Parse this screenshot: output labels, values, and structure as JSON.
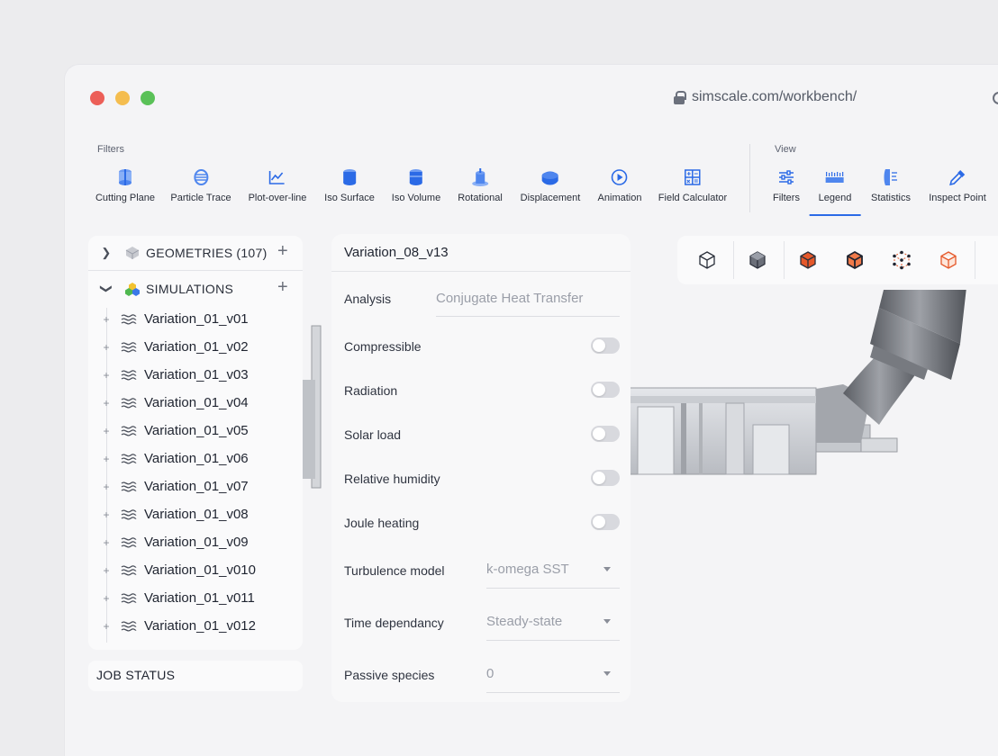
{
  "browser": {
    "url": "simscale.com/workbench/"
  },
  "toolbar": {
    "filters_label": "Filters",
    "view_label": "View",
    "filters": [
      {
        "label": "Cutting Plane",
        "icon": "cutting-plane-icon"
      },
      {
        "label": "Particle Trace",
        "icon": "particle-trace-icon"
      },
      {
        "label": "Plot-over-line",
        "icon": "plot-over-line-icon"
      },
      {
        "label": "Iso Surface",
        "icon": "iso-surface-icon"
      },
      {
        "label": "Iso Volume",
        "icon": "iso-volume-icon"
      },
      {
        "label": "Rotational",
        "icon": "rotational-icon"
      },
      {
        "label": "Displacement",
        "icon": "displacement-icon"
      },
      {
        "label": "Animation",
        "icon": "animation-icon"
      },
      {
        "label": "Field Calculator",
        "icon": "field-calculator-icon"
      }
    ],
    "view": [
      {
        "label": "Filters",
        "icon": "filters-icon"
      },
      {
        "label": "Legend",
        "icon": "legend-icon",
        "active": true
      },
      {
        "label": "Statistics",
        "icon": "statistics-icon"
      },
      {
        "label": "Inspect Point",
        "icon": "inspect-point-icon"
      }
    ]
  },
  "tree": {
    "geometries": {
      "label": "GEOMETRIES",
      "count": "(107)"
    },
    "simulations": {
      "label": "SIMULATIONS"
    },
    "items": [
      "Variation_01_v01",
      "Variation_01_v02",
      "Variation_01_v03",
      "Variation_01_v04",
      "Variation_01_v05",
      "Variation_01_v06",
      "Variation_01_v07",
      "Variation_01_v08",
      "Variation_01_v09",
      "Variation_01_v010",
      "Variation_01_v011",
      "Variation_01_v012"
    ],
    "job_status": "JOB STATUS"
  },
  "panel": {
    "title": "Variation_08_v13",
    "analysis": {
      "label": "Analysis",
      "value": "Conjugate Heat Transfer"
    },
    "toggles": [
      {
        "label": "Compressible",
        "on": false
      },
      {
        "label": "Radiation",
        "on": false
      },
      {
        "label": "Solar load",
        "on": false
      },
      {
        "label": "Relative humidity",
        "on": false
      },
      {
        "label": "Joule heating",
        "on": false
      }
    ],
    "selects": [
      {
        "label": "Turbulence model",
        "value": "k-omega SST"
      },
      {
        "label": "Time dependancy",
        "value": "Steady-state"
      },
      {
        "label": "Passive species",
        "value": "0"
      }
    ]
  },
  "viewbar": {
    "buttons": [
      "wireframe-cube-icon",
      "solid-cube-icon",
      "orange-solid-cube-icon",
      "orange-edges-cube-icon",
      "vertices-cube-icon",
      "orange-outline-cube-icon"
    ]
  },
  "colors": {
    "accent": "#2b6ae6",
    "orange": "#e5582a"
  }
}
